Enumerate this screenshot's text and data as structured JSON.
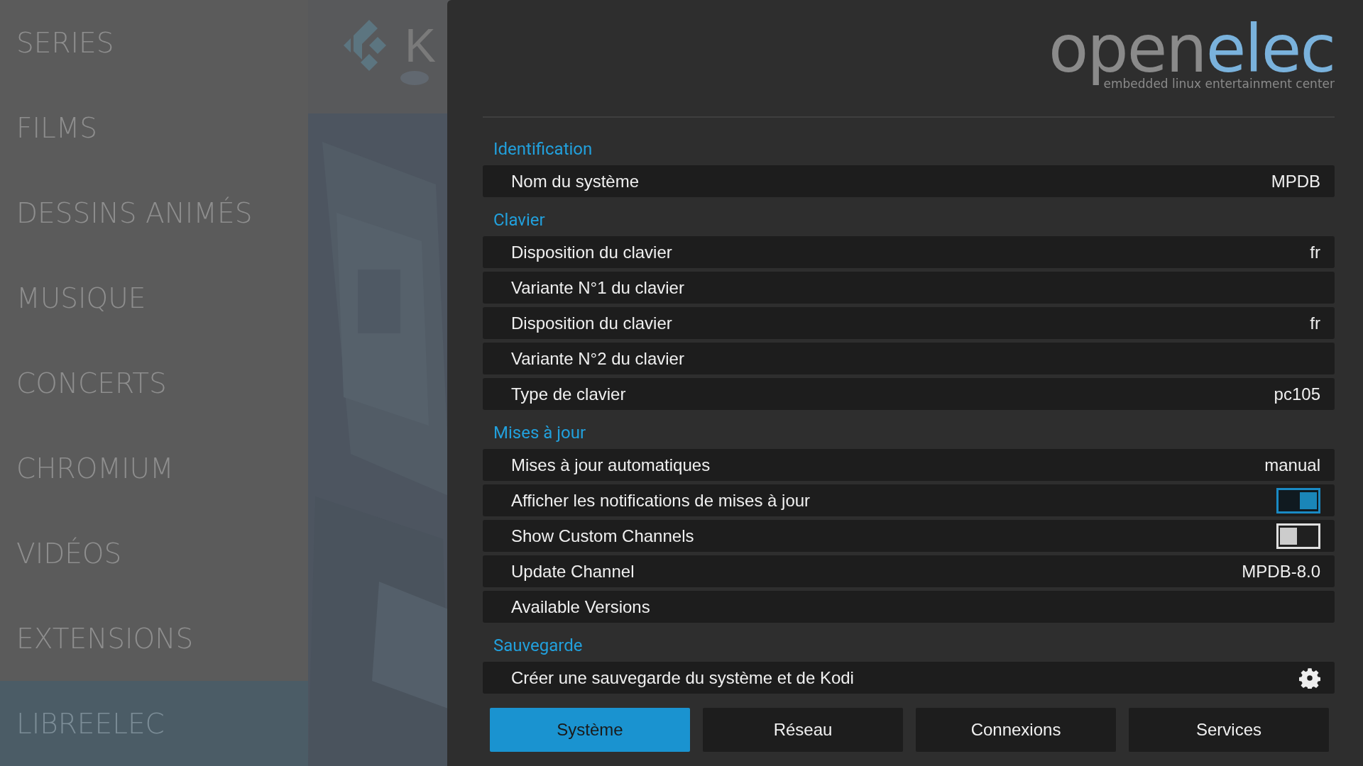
{
  "menu": [
    {
      "label": "SERIES",
      "selected": false
    },
    {
      "label": "FILMS",
      "selected": false
    },
    {
      "label": "DESSINS ANIMÉS",
      "selected": false
    },
    {
      "label": "MUSIQUE",
      "selected": false
    },
    {
      "label": "CONCERTS",
      "selected": false
    },
    {
      "label": "CHROMIUM",
      "selected": false
    },
    {
      "label": "VIDÉOS",
      "selected": false
    },
    {
      "label": "EXTENSIONS",
      "selected": false
    },
    {
      "label": "LIBREELEC",
      "selected": true
    }
  ],
  "background_logo": {
    "text": "K"
  },
  "brand": {
    "name_part1": "open",
    "name_part2": "elec",
    "tagline": "embedded linux entertainment center"
  },
  "sections": [
    {
      "title": "Identification",
      "rows": [
        {
          "kind": "value",
          "label": "Nom du système",
          "value": "MPDB"
        }
      ]
    },
    {
      "title": "Clavier",
      "rows": [
        {
          "kind": "value",
          "label": "Disposition du clavier",
          "value": "fr"
        },
        {
          "kind": "value",
          "label": "Variante N°1 du clavier"
        },
        {
          "kind": "value",
          "label": "Disposition du clavier",
          "value": "fr"
        },
        {
          "kind": "value",
          "label": "Variante N°2 du clavier"
        },
        {
          "kind": "value",
          "label": "Type de clavier",
          "value": "pc105"
        }
      ]
    },
    {
      "title": "Mises à jour",
      "rows": [
        {
          "kind": "value",
          "label": "Mises à jour automatiques",
          "value": "manual"
        },
        {
          "kind": "toggle",
          "label": "Afficher les notifications de mises à jour",
          "on": true
        },
        {
          "kind": "toggle",
          "label": "Show Custom Channels",
          "on": false
        },
        {
          "kind": "value",
          "label": "Update Channel",
          "value": "MPDB-8.0"
        },
        {
          "kind": "value",
          "label": "Available Versions"
        }
      ]
    },
    {
      "title": "Sauvegarde",
      "rows": [
        {
          "kind": "action",
          "label": "Créer une sauvegarde du système et de Kodi"
        }
      ]
    }
  ],
  "tabs": [
    {
      "label": "Système",
      "selected": true
    },
    {
      "label": "Réseau",
      "selected": false
    },
    {
      "label": "Connexions",
      "selected": false
    },
    {
      "label": "Services",
      "selected": false
    }
  ]
}
